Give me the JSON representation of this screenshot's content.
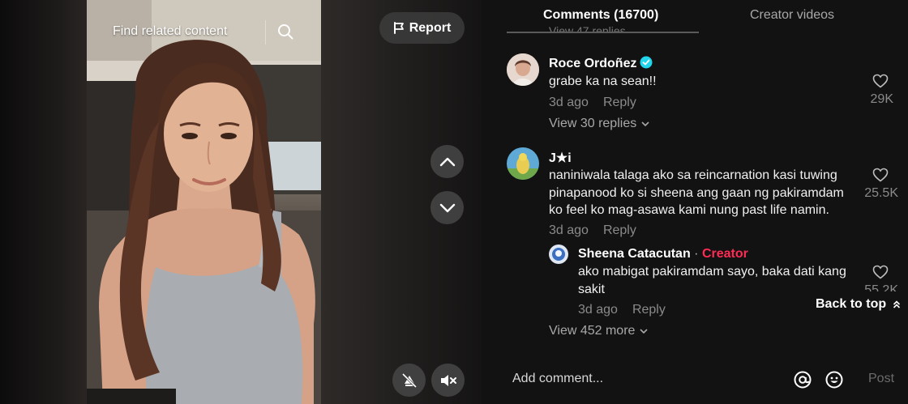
{
  "video": {
    "find_related": "Find related content",
    "report_label": "Report",
    "icons": [
      "search-icon",
      "flag-icon",
      "chevron-up-icon",
      "chevron-down-icon",
      "no-filter-icon",
      "mute-icon"
    ]
  },
  "tabs": {
    "comments": "Comments (16700)",
    "creator_videos": "Creator videos"
  },
  "ghost_text": "View 47 replies",
  "comments": [
    {
      "author": "Roce Ordoñez",
      "verified": true,
      "text": "grabe ka na sean!!",
      "time": "3d ago",
      "reply": "Reply",
      "likes": "29K",
      "view_replies": "View 30 replies"
    },
    {
      "author": "J★i",
      "text": "naniniwala talaga ako sa reincarnation kasi tuwing pinapanood ko si sheena ang gaan ng pakiramdam ko feel ko mag-asawa kami nung past life namin.",
      "time": "3d ago",
      "reply": "Reply",
      "likes": "25.5K",
      "reply_thread": {
        "author": "Sheena Catacutan",
        "separator": "·",
        "tag": "Creator",
        "text": "ako mabigat pakiramdam sayo, baka dati kang sakit",
        "time": "3d ago",
        "reply": "Reply",
        "likes": "55.2K"
      },
      "view_more": "View 452 more"
    }
  ],
  "back_to_top": "Back to top",
  "composer": {
    "placeholder": "Add comment...",
    "post_label": "Post"
  },
  "colors": {
    "background": "#121212",
    "creator_tag": "#fe2c55",
    "verified_badge": "#20d5ec"
  }
}
